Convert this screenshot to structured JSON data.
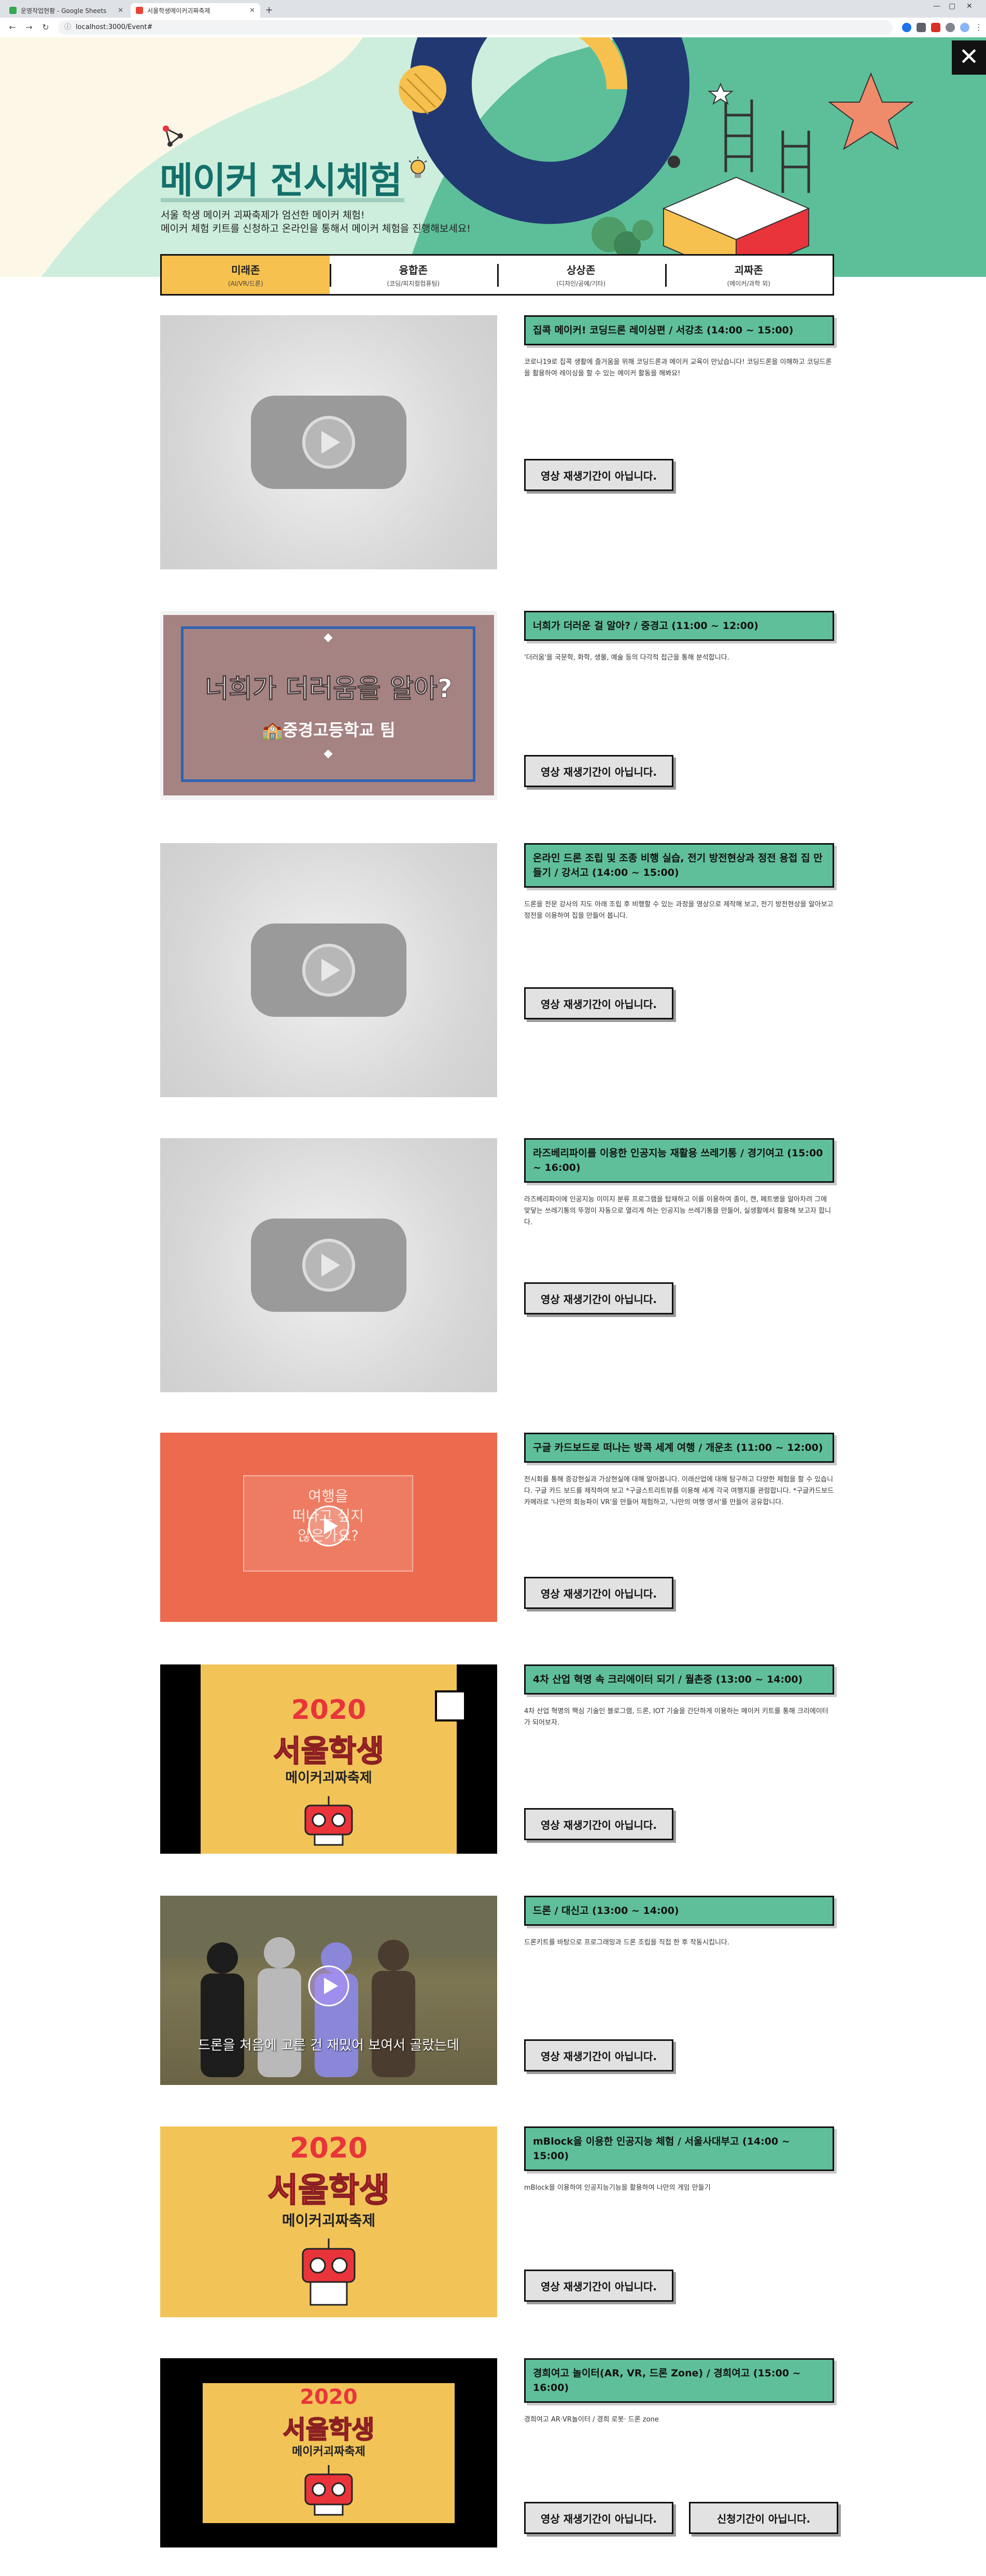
{
  "browser": {
    "tabs": [
      {
        "title": "운영작업현황 - Google Sheets",
        "active": false,
        "color": "#34a853"
      },
      {
        "title": "서울학생메이커괴짜축제",
        "active": true,
        "color": "#ea4335"
      }
    ],
    "new_tab_symbol": "+",
    "url": "localhost:3000/Event#"
  },
  "hero": {
    "title": "메이커 전시체험",
    "desc_line1": "서울 학생 메이커 괴짜축제가 엄선한 메이커 체험!",
    "desc_line2": "메이커 체험 키트를 신청하고 온라인을 통해서 메이커 체험을 진행해보세요!",
    "close_symbol": "✕"
  },
  "zones": [
    {
      "name": "미래존",
      "sub": "(AI/VR/드론)",
      "active": true
    },
    {
      "name": "융합존",
      "sub": "(코딩/피지컬컴퓨팅)",
      "active": false
    },
    {
      "name": "상상존",
      "sub": "(디자인/공예/기타)",
      "active": false
    },
    {
      "name": "괴짜존",
      "sub": "(메이커/과학 외)",
      "active": false
    }
  ],
  "items": [
    {
      "title": "집콕 메이커! 코딩드론 레이싱편 / 서강초 (14:00 ~ 15:00)",
      "desc": "코로나19로 집콕 생활에 즐거움을 위해 코딩드론과 메이커 교육이 만났습니다! 코딩드론을 이해하고 코딩드론을 활용하여 레이싱을 할 수 있는 메이커 활동을 해봐요!",
      "buttons": [
        "영상 재생기간이 아닙니다."
      ],
      "thumb": "placeholder"
    },
    {
      "title": "너희가 더러운 걸 알아? / 중경고 (11:00 ~ 12:00)",
      "desc": "'더러움'을 국문학, 화학, 생물, 예술 등의 다각적 접근을 통해 분석합니다.",
      "buttons": [
        "영상 재생기간이 아닙니다."
      ],
      "thumb": "dirty",
      "thumb_title": "너희가 더러움을 알아?",
      "thumb_sub": "중경고등학교 팀"
    },
    {
      "title": "온라인 드론 조립 및 조종 비행 실습, 전기 방전현상과 정전 용접 집 만들기 / 강서고 (14:00 ~ 15:00)",
      "desc": "드론을 전문 강사의 지도 아래 조립 후 비행할 수 있는 과정을 영상으로 제작해 보고, 전기 방전현상을 알아보고 정전을 이용하여 집을 만들어 봅니다.",
      "buttons": [
        "영상 재생기간이 아닙니다."
      ],
      "thumb": "placeholder"
    },
    {
      "title": "라즈베리파이를 이용한 인공지능 재활용 쓰레기통 / 경기여고 (15:00 ~ 16:00)",
      "desc": "라즈베리파이에 인공지능 이미지 분류 프로그램을 탑재하고 이를 이용하여 종이, 캔, 페트병을 알아차려 그에 맞닿는 쓰레기통의 뚜껑이 자동으로 열리게 하는 인공지능 쓰레기통을 만들어, 실생활에서 활용해 보고자 합니다.",
      "buttons": [
        "영상 재생기간이 아닙니다."
      ],
      "thumb": "placeholder"
    },
    {
      "title": "구글 카드보드로 떠나는 방콕 세계 여행 / 개운초 (11:00 ~ 12:00)",
      "desc": "전시회를 통해 증강현실과 가상현실에 대해 알아봅니다. 이래산업에 대해 탐구하고 다양한 체험을 할 수 있습니다. 구글 카드 보드를 제작하여 보고 *구글스트리트뷰를 이용해 세계 각국 여행지를 관람합니다. *구글카드보드 카메라로 '나만의 회능파이 VR'을 만들어 체험하고, '나만의 여행 영서'를 만들어 공유합니다.",
      "buttons": [
        "영상 재생기간이 아닙니다."
      ],
      "thumb": "travel",
      "thumb_text": "여행을\n떠나고 싶지\n않은가요?"
    },
    {
      "title": "4차 산업 혁명 속 크리에이터 되기 / 월촌중 (13:00 ~ 14:00)",
      "desc": "4차 산업 혁명의 핵심 기술인 블로그램, 드론, IOT 기술을 간단하게 이용하는 메이커 키트를 통해 크리에이터가 되어보자.",
      "buttons": [
        "영상 재생기간이 아닙니다."
      ],
      "thumb": "festival_video",
      "thumb_year": "2020",
      "thumb_title": "서울학생",
      "thumb_sub": "메이커괴짜축제"
    },
    {
      "title": "드론 / 대신고 (13:00 ~ 14:00)",
      "desc": "드론키트를 바탕으로 프로그래밍과 드론 조립을 직접 한 후 작동시킵니다.",
      "buttons": [
        "영상 재생기간이 아닙니다."
      ],
      "thumb": "students",
      "thumb_caption": "드론을 처음에 고른 건 재밌어 보여서 골랐는데"
    },
    {
      "title": "mBlock을 이용한 인공지능 체험 / 서울사대부고 (14:00 ~ 15:00)",
      "desc": "mBlock을 이용하여 인공지능기능을 활용하여 나만의 게임 만들기",
      "buttons": [
        "영상 재생기간이 아닙니다."
      ],
      "thumb": "festival_poster",
      "thumb_year": "2020",
      "thumb_title": "서울학생",
      "thumb_sub": "메이커괴짜축제"
    },
    {
      "title": "경희여고 놀이터(AR, VR, 드론 Zone) / 경희여고 (15:00 ~ 16:00)",
      "desc": "경희여고 AR·VR놀이터 / 경희 로봇· 드론 zone",
      "buttons": [
        "영상 재생기간이 아닙니다.",
        "신청기간이 아닙니다."
      ],
      "thumb": "festival_black",
      "thumb_year": "2020",
      "thumb_title": "서울학생",
      "thumb_sub": "메이커괴짜축제"
    }
  ]
}
